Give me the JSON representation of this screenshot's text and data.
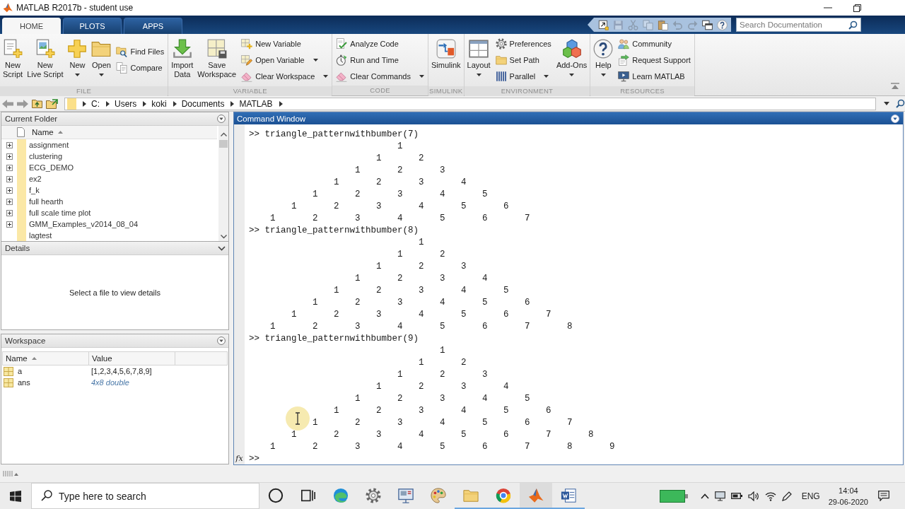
{
  "window": {
    "title": "MATLAB R2017b - student use"
  },
  "tabs": [
    {
      "label": "HOME",
      "selected": true
    },
    {
      "label": "PLOTS",
      "selected": false
    },
    {
      "label": "APPS",
      "selected": false
    }
  ],
  "quick_access": {
    "buttons": [
      {
        "disabled": false
      },
      {
        "disabled": true
      },
      {
        "disabled": true
      },
      {
        "disabled": true
      },
      {
        "disabled": false
      },
      {
        "disabled": true
      },
      {
        "disabled": true
      },
      {
        "disabled": false
      },
      {
        "disabled": false
      }
    ],
    "search": {
      "placeholder": "Search Documentation"
    }
  },
  "toolstrip": {
    "sections": [
      {
        "label": "FILE",
        "buttons": [
          {
            "kind": "large",
            "label": "New\nScript",
            "dropdown": false
          },
          {
            "kind": "large",
            "label": "New\nLive Script",
            "dropdown": false
          },
          {
            "kind": "large",
            "label": "New",
            "dropdown": true
          },
          {
            "kind": "large",
            "label": "Open",
            "dropdown": true
          },
          {
            "kind": "small",
            "label": "Find Files",
            "dropdown": false
          },
          {
            "kind": "small",
            "label": "Compare",
            "dropdown": false
          }
        ]
      },
      {
        "label": "VARIABLE",
        "buttons": [
          {
            "kind": "large",
            "label": "Import\nData",
            "dropdown": false
          },
          {
            "kind": "large",
            "label": "Save\nWorkspace",
            "dropdown": false
          },
          {
            "kind": "small",
            "label": "New Variable",
            "dropdown": false
          },
          {
            "kind": "small",
            "label": "Open Variable",
            "dropdown": true
          },
          {
            "kind": "small",
            "label": "Clear Workspace",
            "dropdown": true
          }
        ]
      },
      {
        "label": "CODE",
        "buttons": [
          {
            "kind": "small",
            "label": "Analyze Code",
            "dropdown": false
          },
          {
            "kind": "small",
            "label": "Run and Time",
            "dropdown": false
          },
          {
            "kind": "small",
            "label": "Clear Commands",
            "dropdown": true
          }
        ]
      },
      {
        "label": "SIMULINK",
        "buttons": [
          {
            "kind": "large",
            "label": "Simulink",
            "dropdown": false
          }
        ]
      },
      {
        "label": "ENVIRONMENT",
        "buttons": [
          {
            "kind": "large",
            "label": "Layout",
            "dropdown": true
          },
          {
            "kind": "small",
            "label": "Preferences",
            "dropdown": false
          },
          {
            "kind": "small",
            "label": "Set Path",
            "dropdown": false
          },
          {
            "kind": "small",
            "label": "Parallel",
            "dropdown": true
          },
          {
            "kind": "large",
            "label": "Add-Ons",
            "dropdown": true
          }
        ]
      },
      {
        "label": "RESOURCES",
        "buttons": [
          {
            "kind": "large",
            "label": "Help",
            "dropdown": true
          },
          {
            "kind": "small",
            "label": "Community",
            "dropdown": false
          },
          {
            "kind": "small",
            "label": "Request Support",
            "dropdown": false
          },
          {
            "kind": "small",
            "label": "Learn MATLAB",
            "dropdown": false
          }
        ]
      }
    ]
  },
  "address_bar": {
    "path": [
      "C:",
      "Users",
      "koki",
      "Documents",
      "MATLAB"
    ]
  },
  "current_folder": {
    "title": "Current Folder",
    "column": "Name",
    "items": [
      {
        "name": "assignment",
        "expandable": true
      },
      {
        "name": "clustering",
        "expandable": true
      },
      {
        "name": "ECG_DEMO",
        "expandable": true
      },
      {
        "name": "ex2",
        "expandable": true
      },
      {
        "name": "f_k",
        "expandable": true
      },
      {
        "name": "full hearth",
        "expandable": true
      },
      {
        "name": "full scale time plot",
        "expandable": true
      },
      {
        "name": "GMM_Examples_v2014_08_04",
        "expandable": true
      },
      {
        "name": "lagtest",
        "expandable": false
      }
    ]
  },
  "details": {
    "title": "Details",
    "message": "Select a file to view details"
  },
  "workspace": {
    "title": "Workspace",
    "columns": [
      "Name",
      "Value"
    ],
    "rows": [
      {
        "name": "a",
        "value": "[1,2,3,4,5,6,7,8,9]",
        "kind": "literal"
      },
      {
        "name": "ans",
        "value": "4x8 double",
        "kind": "summary"
      }
    ]
  },
  "command_window": {
    "title": "Command Window",
    "entries": [
      {
        "prompt": ">>",
        "command": "triangle_patternwithbumber(7)",
        "output": [
          [
            "1"
          ],
          [
            "1",
            "2"
          ],
          [
            "1",
            "2",
            "3"
          ],
          [
            "1",
            "2",
            "3",
            "4"
          ],
          [
            "1",
            "2",
            "3",
            "4",
            "5"
          ],
          [
            "1",
            "2",
            "3",
            "4",
            "5",
            "6"
          ],
          [
            "1",
            "2",
            "3",
            "4",
            "5",
            "6",
            "7"
          ]
        ]
      },
      {
        "prompt": ">>",
        "command": "triangle_patternwithbumber(8)",
        "output": [
          [
            "1"
          ],
          [
            "1",
            "2"
          ],
          [
            "1",
            "2",
            "3"
          ],
          [
            "1",
            "2",
            "3",
            "4"
          ],
          [
            "1",
            "2",
            "3",
            "4",
            "5"
          ],
          [
            "1",
            "2",
            "3",
            "4",
            "5",
            "6"
          ],
          [
            "1",
            "2",
            "3",
            "4",
            "5",
            "6",
            "7"
          ],
          [
            "1",
            "2",
            "3",
            "4",
            "5",
            "6",
            "7",
            "8"
          ]
        ]
      },
      {
        "prompt": ">>",
        "command": "triangle_patternwithbumber(9)",
        "output": [
          [
            "1"
          ],
          [
            "1",
            "2"
          ],
          [
            "1",
            "2",
            "3"
          ],
          [
            "1",
            "2",
            "3",
            "4"
          ],
          [
            "1",
            "2",
            "3",
            "4",
            "5"
          ],
          [
            "1",
            "2",
            "3",
            "4",
            "5",
            "6"
          ],
          [
            "1",
            "2",
            "3",
            "4",
            "5",
            "6",
            "7"
          ],
          [
            "1",
            "2",
            "3",
            "4",
            "5",
            "6",
            "7",
            "8"
          ],
          [
            "1",
            "2",
            "3",
            "4",
            "5",
            "6",
            "7",
            "8",
            "9"
          ]
        ]
      }
    ],
    "function_button": "fx",
    "input_prompt": ">>"
  },
  "taskbar": {
    "search": {
      "placeholder": "Type here to search"
    },
    "apps": [
      {
        "running": false,
        "selected": false
      },
      {
        "running": false,
        "selected": false
      },
      {
        "running": false,
        "selected": false
      },
      {
        "running": false,
        "selected": false
      },
      {
        "running": false,
        "selected": false
      },
      {
        "running": false,
        "selected": false
      },
      {
        "running": true,
        "selected": false
      },
      {
        "running": true,
        "selected": false
      },
      {
        "running": true,
        "selected": true
      },
      {
        "running": true,
        "selected": false
      }
    ],
    "tray": {
      "language": "ENG",
      "time": "14:04",
      "date": "29-06-2020"
    }
  }
}
